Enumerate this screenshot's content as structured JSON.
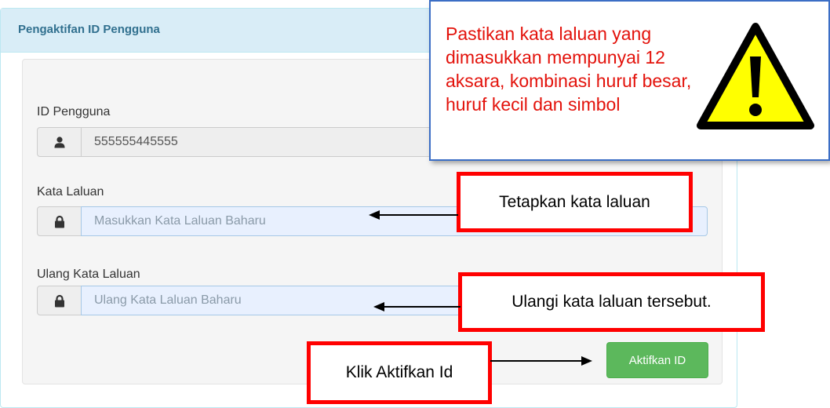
{
  "panel": {
    "title": "Pengaktifan ID Pengguna"
  },
  "form": {
    "user_id": {
      "label": "ID Pengguna",
      "value": "555555445555",
      "icon": "user-icon"
    },
    "password": {
      "label": "Kata Laluan",
      "placeholder": "Masukkan Kata Laluan Baharu",
      "icon": "lock-icon"
    },
    "confirm_password": {
      "label": "Ulang Kata Laluan",
      "placeholder": "Ulang Kata Laluan Baharu",
      "icon": "lock-icon"
    },
    "submit_label": "Aktifkan ID"
  },
  "annotations": {
    "warning_text": "Pastikan kata laluan yang dimasukkan mempunyai 12 aksara, kombinasi huruf besar, huruf kecil dan simbol",
    "set_password": "Tetapkan kata laluan",
    "repeat_password": "Ulangi kata laluan tersebut.",
    "click_activate": "Klik Aktifkan Id"
  },
  "colors": {
    "panel_heading_bg": "#d9edf7",
    "panel_heading_text": "#31708f",
    "button_green": "#5cb85c",
    "annotation_red": "#ff0000",
    "warning_text_red": "#e3120b",
    "warning_yellow": "#ffff00"
  }
}
